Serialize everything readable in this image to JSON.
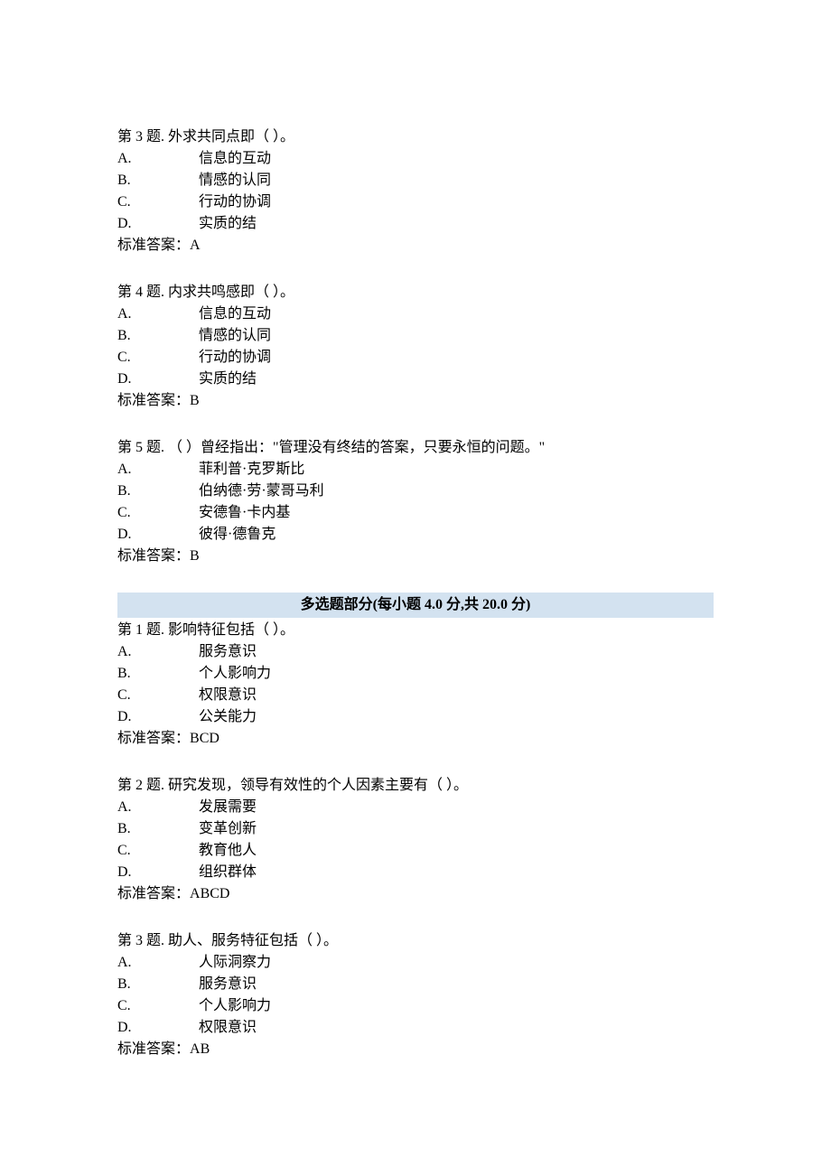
{
  "question_prefix": "第",
  "question_word_ti": "题.",
  "answer_prefix": "标准答案：",
  "single": {
    "q3": {
      "number": "3",
      "text": "  外求共同点即（ ）。",
      "options": [
        {
          "letter": "A.",
          "text": "信息的互动"
        },
        {
          "letter": "B.",
          "text": "情感的认同"
        },
        {
          "letter": "C.",
          "text": "行动的协调"
        },
        {
          "letter": "D.",
          "text": "实质的结"
        }
      ],
      "answer": "A"
    },
    "q4": {
      "number": "4",
      "text": "  内求共鸣感即（ ）。",
      "options": [
        {
          "letter": "A.",
          "text": "信息的互动"
        },
        {
          "letter": "B.",
          "text": "情感的认同"
        },
        {
          "letter": "C.",
          "text": "行动的协调"
        },
        {
          "letter": "D.",
          "text": "实质的结"
        }
      ],
      "answer": "B"
    },
    "q5": {
      "number": "5",
      "text": " （ ）曾经指出：\"管理没有终结的答案，只要永恒的问题。\"",
      "options": [
        {
          "letter": "A.",
          "text": "菲利普·克罗斯比"
        },
        {
          "letter": "B.",
          "text": "伯纳德·劳·蒙哥马利"
        },
        {
          "letter": "C.",
          "text": "安德鲁·卡内基"
        },
        {
          "letter": "D.",
          "text": "彼得·德鲁克"
        }
      ],
      "answer": "B"
    }
  },
  "section_header": "多选题部分(每小题 4.0 分,共 20.0 分)",
  "multi": {
    "q1": {
      "number": "1",
      "text": "  影响特征包括（ ）。",
      "options": [
        {
          "letter": "A.",
          "text": "服务意识"
        },
        {
          "letter": "B.",
          "text": "个人影响力"
        },
        {
          "letter": "C.",
          "text": "权限意识"
        },
        {
          "letter": "D.",
          "text": "公关能力"
        }
      ],
      "answer": "BCD"
    },
    "q2": {
      "number": "2",
      "text": "  研究发现，领导有效性的个人因素主要有（ ）。",
      "options": [
        {
          "letter": "A.",
          "text": "发展需要"
        },
        {
          "letter": "B.",
          "text": "变革创新"
        },
        {
          "letter": "C.",
          "text": "教育他人"
        },
        {
          "letter": "D.",
          "text": "组织群体"
        }
      ],
      "answer": "ABCD"
    },
    "q3": {
      "number": "3",
      "text": "  助人、服务特征包括（ ）。",
      "options": [
        {
          "letter": "A.",
          "text": "人际洞察力"
        },
        {
          "letter": "B.",
          "text": "服务意识"
        },
        {
          "letter": "C.",
          "text": "个人影响力"
        },
        {
          "letter": "D.",
          "text": "权限意识"
        }
      ],
      "answer": "AB"
    }
  }
}
